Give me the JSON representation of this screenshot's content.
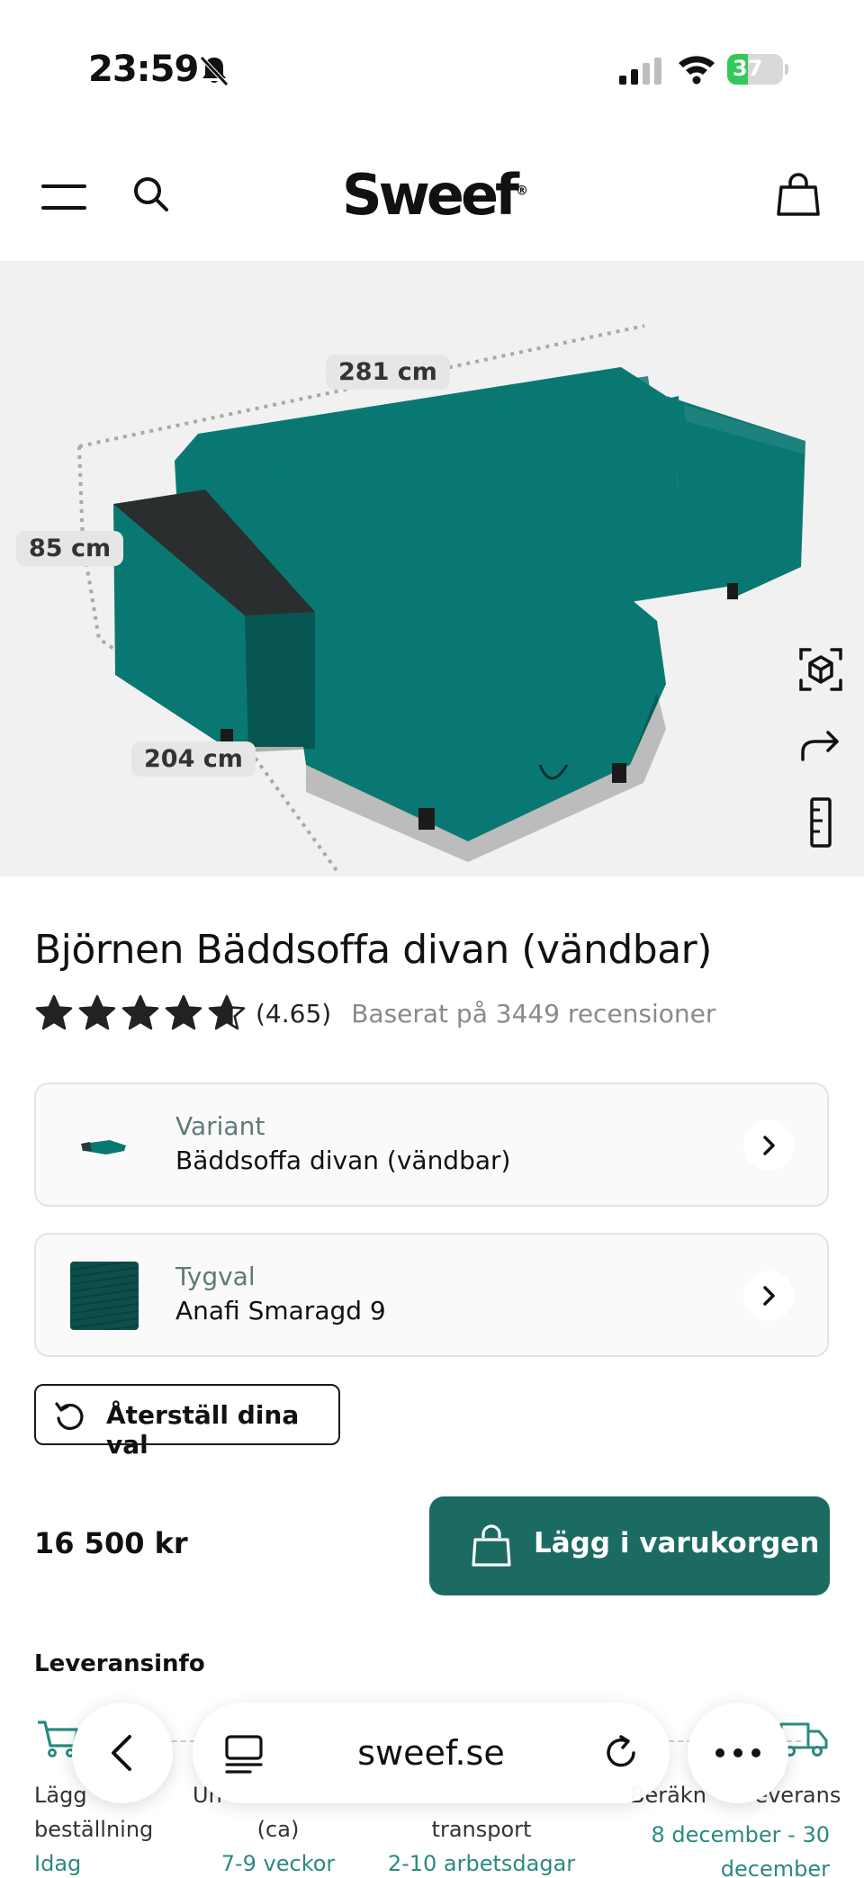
{
  "status_bar": {
    "time": "23:59",
    "battery": "37",
    "battery_level": 0.37
  },
  "header": {
    "logo": "Sweef",
    "logo_mark": "®"
  },
  "hero": {
    "dimensions": {
      "width": "281 cm",
      "height": "85 cm",
      "depth": "204 cm"
    },
    "sofa_color": "#0a7872",
    "tools": [
      "ar-view-icon",
      "share-icon",
      "ruler-icon"
    ]
  },
  "product": {
    "title": "Björnen Bäddsoffa divan (vändbar)",
    "rating_value": 4.65,
    "rating_text": "(4.65)",
    "review_text": "Baserat på 3449 recensioner"
  },
  "options": {
    "variant": {
      "label": "Variant",
      "value": "Bäddsoffa divan (vändbar)"
    },
    "fabric": {
      "label": "Tygval",
      "value": "Anafi Smaragd 9"
    }
  },
  "reset_label": "Återställ dina val",
  "price": "16 500 kr",
  "add_to_cart": "Lägg i varukorgen",
  "delivery": {
    "title": "Leveransinfo",
    "step1": {
      "line1": "Lägg",
      "line2": "beställning",
      "when": "Idag"
    },
    "step2": {
      "line1": "Un",
      "line2": "(ca)",
      "when": "7-9 veckor"
    },
    "step3": {
      "line1": "transport",
      "when": "2-10 arbetsdagar"
    },
    "step4": {
      "line1": "Beräkn",
      "line1b": "everans",
      "when_line1": "8 december - 30",
      "when_line2": "december"
    }
  },
  "browser": {
    "url": "sweef.se"
  },
  "colors": {
    "brand_green": "#1b6b63",
    "accent_text": "#2a8a80"
  }
}
